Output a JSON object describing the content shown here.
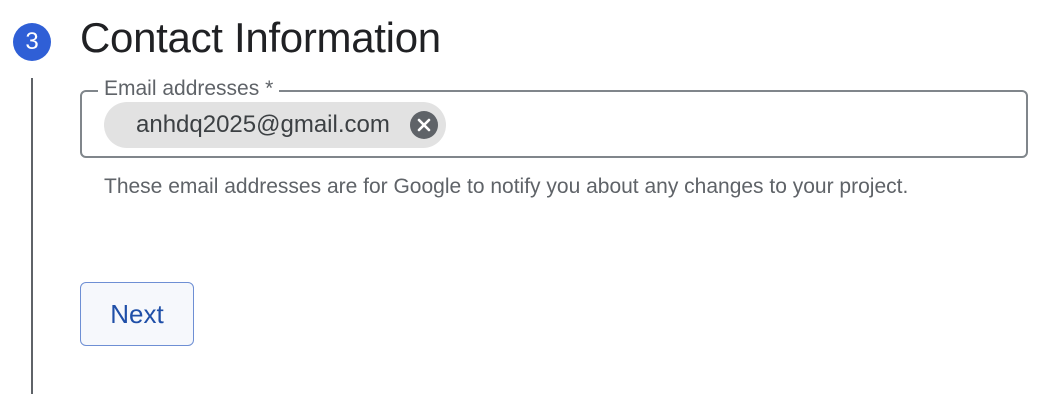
{
  "step": {
    "number": "3",
    "title": "Contact Information"
  },
  "email_field": {
    "label": "Email addresses *",
    "chips": [
      "anhdq2025@gmail.com"
    ],
    "helper_text": "These email addresses are for Google to notify you about any changes to your project."
  },
  "actions": {
    "next_label": "Next"
  },
  "colors": {
    "step_badge": "#2f5fd6",
    "button_text": "#1f4fa8",
    "chip_background": "#e2e2e2"
  },
  "icons": {
    "chip_remove": "cancel-icon"
  }
}
